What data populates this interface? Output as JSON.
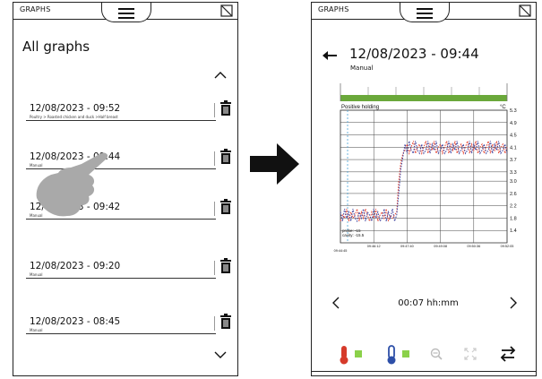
{
  "left_screen": {
    "tab_label": "GRAPHS",
    "title": "All graphs",
    "items": [
      {
        "datetime": "12/08/2023 - 09:52",
        "subtitle": "Poultry > Roasted chicken and duck >Half breast"
      },
      {
        "datetime": "12/08/2023 - 09:44",
        "subtitle": "Manual"
      },
      {
        "datetime": "12/08/2023 - 09:42",
        "subtitle": "Manual"
      },
      {
        "datetime": "12/08/2023 - 09:20",
        "subtitle": "Manual"
      },
      {
        "datetime": "12/08/2023 - 08:45",
        "subtitle": "Manual"
      }
    ]
  },
  "right_screen": {
    "tab_label": "GRAPHS",
    "title": "12/08/2023 - 09:44",
    "subtitle": "Manual",
    "duration": "00:07 hh:mm",
    "chart_data": {
      "type": "line",
      "title": "Positive holding",
      "ylabel": "°C",
      "ylim": [
        1.0,
        5.3
      ],
      "yticks": [
        "5.3",
        "4.9",
        "4.5",
        "4.1",
        "3.7",
        "3.3",
        "3.0",
        "2.6",
        "2.2",
        "1.8",
        "1.4"
      ],
      "xticks": [
        "09:44:45",
        "09:46:12",
        "09:47:40",
        "09:49:08",
        "09:50:36",
        "09:52:05"
      ],
      "annotation": [
        "probe: -15",
        "cavity: -15.5"
      ],
      "series": [
        {
          "color": "#e8432e",
          "x": [
            0,
            0.5,
            1,
            1.5,
            2,
            2.5,
            3,
            3.5,
            4,
            4.5,
            5,
            5.5,
            6,
            6.5,
            7,
            7.5,
            8,
            8.5,
            9,
            9.5,
            10,
            10.5,
            11,
            11.5,
            12,
            12.5,
            13,
            13.5,
            14,
            14.5,
            15,
            15.5,
            16,
            16.5,
            17,
            17.5,
            18,
            18.5,
            19,
            19.5,
            20,
            20.5,
            21,
            21.5,
            22,
            22.5,
            23,
            23.5,
            24,
            24.5,
            25,
            25.5,
            26,
            26.5,
            27,
            27.5,
            28,
            28.5,
            29,
            29.5,
            30,
            30.5,
            31,
            31.5,
            32,
            32.5,
            33,
            33.5,
            34,
            34.5,
            35,
            35.5,
            36,
            36.5,
            37,
            37.5,
            38,
            38.5,
            39,
            39.5,
            40
          ],
          "y": [
            1.7,
            1.9,
            1.8,
            2.1,
            1.7,
            2.0,
            1.8,
            1.9,
            2.1,
            1.7,
            2.0,
            1.8,
            2.1,
            1.9,
            1.7,
            2.0,
            1.8,
            2.1,
            1.7,
            1.9,
            2.0,
            1.8,
            2.1,
            1.7,
            1.9,
            1.8,
            1.9,
            2.0,
            3.0,
            3.6,
            3.9,
            4.0,
            4.2,
            3.9,
            4.1,
            4.3,
            3.9,
            4.1,
            4.2,
            3.9,
            4.1,
            4.3,
            3.9,
            4.2,
            4.0,
            4.3,
            3.9,
            4.1,
            4.2,
            3.9,
            4.1,
            4.3,
            3.9,
            4.2,
            4.0,
            4.3,
            3.9,
            4.1,
            4.2,
            3.9,
            4.1,
            4.3,
            3.9,
            4.2,
            4.0,
            4.3,
            3.9,
            4.1,
            4.2,
            3.9,
            4.1,
            4.3,
            3.9,
            4.2,
            4.0,
            4.3,
            3.9,
            4.1,
            4.2,
            3.9,
            4.1
          ]
        },
        {
          "color": "#3a3f9e",
          "x": [
            0,
            0.5,
            1,
            1.5,
            2,
            2.5,
            3,
            3.5,
            4,
            4.5,
            5,
            5.5,
            6,
            6.5,
            7,
            7.5,
            8,
            8.5,
            9,
            9.5,
            10,
            10.5,
            11,
            11.5,
            12,
            12.5,
            13,
            13.5,
            14,
            14.5,
            15,
            15.5,
            16,
            16.5,
            17,
            17.5,
            18,
            18.5,
            19,
            19.5,
            20,
            20.5,
            21,
            21.5,
            22,
            22.5,
            23,
            23.5,
            24,
            24.5,
            25,
            25.5,
            26,
            26.5,
            27,
            27.5,
            28,
            28.5,
            29,
            29.5,
            30,
            30.5,
            31,
            31.5,
            32,
            32.5,
            33,
            33.5,
            34,
            34.5,
            35,
            35.5,
            36,
            36.5,
            37,
            37.5,
            38,
            38.5,
            39,
            39.5,
            40
          ],
          "y": [
            2.0,
            1.7,
            2.1,
            1.8,
            2.0,
            1.7,
            2.1,
            1.8,
            1.7,
            2.0,
            1.8,
            2.1,
            1.7,
            2.0,
            1.9,
            1.7,
            2.1,
            1.8,
            2.0,
            1.7,
            1.8,
            2.1,
            1.7,
            2.0,
            1.8,
            2.1,
            1.7,
            1.9,
            2.6,
            3.4,
            3.8,
            4.2,
            3.9,
            4.3,
            4.0,
            3.9,
            4.3,
            4.0,
            3.9,
            4.2,
            3.9,
            4.0,
            4.3,
            3.9,
            4.2,
            4.0,
            4.3,
            3.9,
            4.0,
            4.2,
            3.9,
            4.0,
            4.3,
            3.9,
            4.2,
            4.0,
            4.3,
            3.9,
            4.0,
            4.2,
            3.9,
            4.0,
            4.3,
            3.9,
            4.2,
            4.0,
            4.3,
            3.9,
            4.0,
            4.2,
            3.9,
            4.0,
            4.3,
            3.9,
            4.2,
            4.0,
            4.3,
            3.9,
            4.0,
            4.2,
            3.9
          ]
        }
      ],
      "threshold_bar_color": "#6aa83a",
      "marker_line_color": "#4aa3d8"
    }
  },
  "colors": {
    "accent_green": "#6aa83a",
    "probe_red": "#d63a2a",
    "probe_blue": "#2d4fa8",
    "status_green": "#8bd14a"
  }
}
